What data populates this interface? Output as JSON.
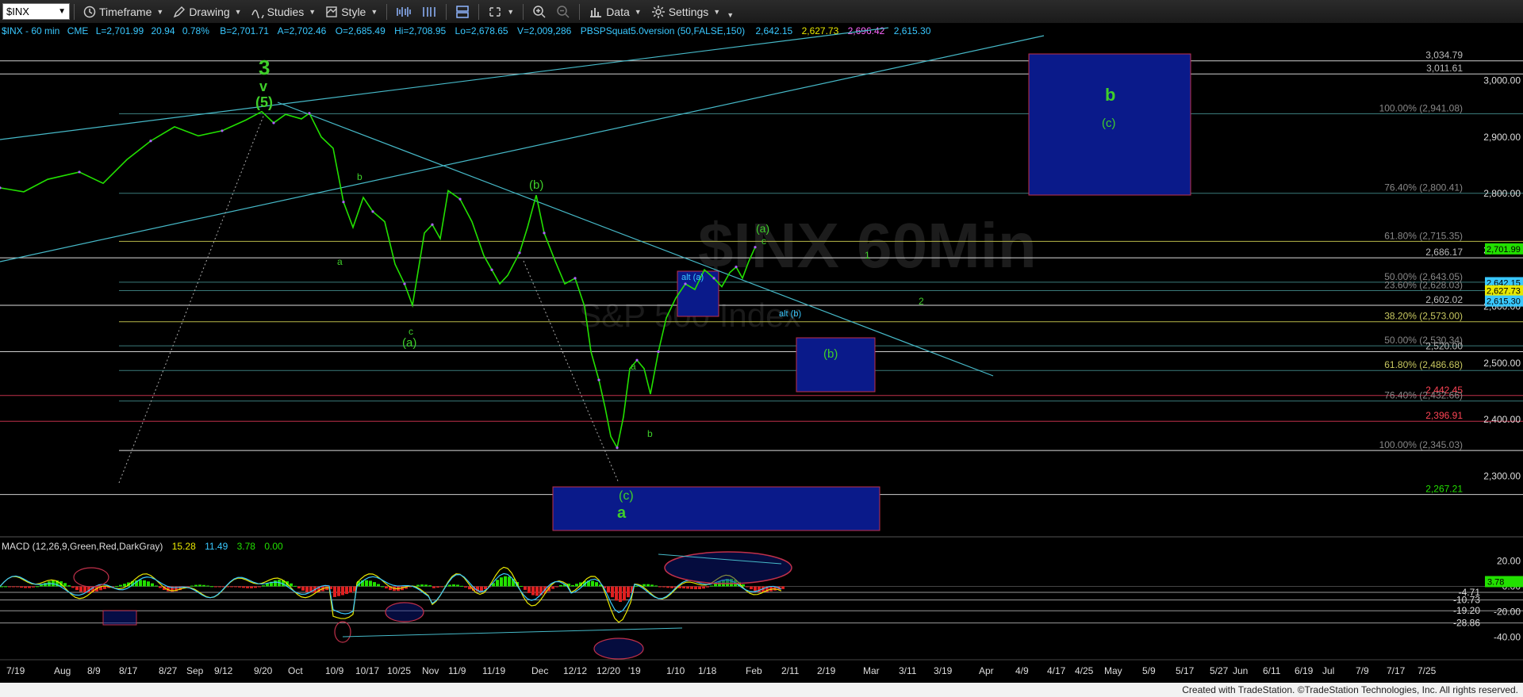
{
  "toolbar": {
    "symbol": "$INX",
    "timeframe_label": "Timeframe",
    "drawing_label": "Drawing",
    "studies_label": "Studies",
    "style_label": "Style",
    "data_label": "Data",
    "settings_label": "Settings"
  },
  "header": {
    "instrument": "$INX - 60 min",
    "exchange": "CME",
    "last": "L=2,701.99",
    "change": "20.94",
    "pct": "0.78%",
    "bid": "B=2,701.71",
    "ask": "A=2,702.46",
    "open": "O=2,685.49",
    "high": "Hi=2,708.95",
    "low": "Lo=2,678.65",
    "volume": "V=2,009,286",
    "study": "PBSPSquat5.0version (50,FALSE,150)",
    "study_values": [
      "2,642.15",
      "2,627.73",
      "2,696.42",
      "2,615.30"
    ]
  },
  "watermark": {
    "line1": "$INX 60Min",
    "line2": "S&P 500 Index"
  },
  "footer": "Created with TradeStation. ©TradeStation Technologies, Inc. All rights reserved.",
  "colors": {
    "price": "#22e000",
    "wave_label": "#3fcf2a",
    "box": "#0a1a8a",
    "trend": "#46b9c8"
  },
  "chart_data": {
    "type": "line",
    "price_axis": {
      "ylim": [
        2250,
        3060
      ],
      "ticks": [
        "3,000.00",
        "2,900.00",
        "2,800.00",
        "2,700.00",
        "2,600.00",
        "2,500.00",
        "2,400.00",
        "2,300.00"
      ]
    },
    "macd_axis": {
      "ylim": [
        -44,
        25
      ],
      "ticks": [
        "20.00",
        "0.00",
        "-20.00",
        "-40.00"
      ]
    },
    "x_tick_labels": [
      "7/19",
      "Aug",
      "8/9",
      "8/17",
      "8/27",
      "Sep",
      "9/12",
      "9/20",
      "Oct",
      "10/9",
      "10/17",
      "10/25",
      "Nov",
      "11/9",
      "11/19",
      "Dec",
      "12/12",
      "12/20",
      "'19",
      "1/10",
      "1/18",
      "Feb",
      "2/11",
      "2/19",
      "Mar",
      "3/11",
      "3/19",
      "Apr",
      "4/9",
      "4/17",
      "4/25",
      "May",
      "5/9",
      "5/17",
      "5/27",
      "Jun",
      "6/11",
      "6/19",
      "Jul",
      "7/9",
      "7/17",
      "7/25"
    ],
    "price_series": {
      "name": "$INX",
      "points": [
        [
          0,
          2810
        ],
        [
          30,
          2803
        ],
        [
          60,
          2825
        ],
        [
          100,
          2838
        ],
        [
          130,
          2818
        ],
        [
          160,
          2860
        ],
        [
          190,
          2893
        ],
        [
          220,
          2918
        ],
        [
          250,
          2902
        ],
        [
          280,
          2911
        ],
        [
          310,
          2930
        ],
        [
          330,
          2945
        ],
        [
          345,
          2925
        ],
        [
          360,
          2940
        ],
        [
          380,
          2932
        ],
        [
          390,
          2942
        ],
        [
          405,
          2900
        ],
        [
          420,
          2880
        ],
        [
          433,
          2785
        ],
        [
          445,
          2740
        ],
        [
          458,
          2793
        ],
        [
          470,
          2768
        ],
        [
          485,
          2750
        ],
        [
          498,
          2675
        ],
        [
          510,
          2640
        ],
        [
          520,
          2602
        ],
        [
          535,
          2730
        ],
        [
          545,
          2745
        ],
        [
          555,
          2720
        ],
        [
          565,
          2805
        ],
        [
          580,
          2790
        ],
        [
          595,
          2750
        ],
        [
          610,
          2690
        ],
        [
          620,
          2665
        ],
        [
          630,
          2640
        ],
        [
          640,
          2655
        ],
        [
          655,
          2695
        ],
        [
          665,
          2740
        ],
        [
          676,
          2797
        ],
        [
          686,
          2730
        ],
        [
          700,
          2680
        ],
        [
          712,
          2640
        ],
        [
          725,
          2650
        ],
        [
          737,
          2600
        ],
        [
          745,
          2520
        ],
        [
          755,
          2470
        ],
        [
          763,
          2420
        ],
        [
          770,
          2370
        ],
        [
          778,
          2350
        ],
        [
          786,
          2405
        ],
        [
          794,
          2490
        ],
        [
          803,
          2505
        ],
        [
          812,
          2490
        ],
        [
          820,
          2445
        ],
        [
          830,
          2520
        ],
        [
          840,
          2580
        ],
        [
          852,
          2615
        ],
        [
          864,
          2640
        ],
        [
          876,
          2630
        ],
        [
          888,
          2665
        ],
        [
          900,
          2650
        ],
        [
          910,
          2635
        ],
        [
          920,
          2660
        ],
        [
          928,
          2670
        ],
        [
          936,
          2650
        ],
        [
          944,
          2680
        ],
        [
          952,
          2705
        ]
      ]
    },
    "macd_series": {
      "name": "MACD (12,26,9,Green,Red,DarkGray)",
      "values": [
        "15.28",
        "11.49",
        "3.78",
        "0.00"
      ]
    },
    "right_labels": [
      {
        "value": 3034.79,
        "text": "3,034.79"
      },
      {
        "value": 3011.61,
        "text": "3,011.61"
      },
      {
        "value": 2941.08,
        "text": "100.00% (2,941.08)"
      },
      {
        "value": 2800.41,
        "text": "76.40% (2,800.41)"
      },
      {
        "value": 2715.35,
        "text": "61.80% (2,715.35)"
      },
      {
        "value": 2686.17,
        "text": "2,686.17"
      },
      {
        "value": 2643.05,
        "text": "50.00% (2,643.05)"
      },
      {
        "value": 2628.03,
        "text": "23.60% (2,628.03)"
      },
      {
        "value": 2602.02,
        "text": "2,602.02"
      },
      {
        "value": 2573.0,
        "text": "38.20% (2,573.00)"
      },
      {
        "value": 2530.34,
        "text": "50.00% (2,530.34)"
      },
      {
        "value": 2520.0,
        "text": "2,520.00"
      },
      {
        "value": 2486.68,
        "text": "61.80% (2,486.68)"
      },
      {
        "value": 2442.45,
        "text": "2,442.45"
      },
      {
        "value": 2432.66,
        "text": "76.40% (2,432.66)"
      },
      {
        "value": 2396.91,
        "text": "2,396.91"
      },
      {
        "value": 2345.03,
        "text": "100.00% (2,345.03)"
      },
      {
        "value": 2267.21,
        "text": "2,267.21"
      }
    ],
    "price_tags": [
      {
        "value": 2701.99,
        "text": "2,701.99"
      },
      {
        "value": 2642.15,
        "text": "2,642.15"
      },
      {
        "value": 2627.73,
        "text": "2,627.73"
      },
      {
        "value": 2615.3,
        "text": "2,615.30"
      }
    ],
    "macd_labels": [
      "-4.71",
      "-10.73",
      "-19.20",
      "-28.86"
    ],
    "macd_tag": "3.78",
    "wave_labels": {
      "three": "3",
      "v": "v",
      "five": "(5)",
      "b_small": "b",
      "a_small": "a",
      "c_small": "c",
      "a_paren": "(a)",
      "b_paren": "(b)",
      "c_paren": "(c)",
      "a_big": "a",
      "b_big": "b",
      "alt_a": "alt (a)",
      "alt_b": "alt (b)",
      "one": "1",
      "two": "2"
    }
  }
}
